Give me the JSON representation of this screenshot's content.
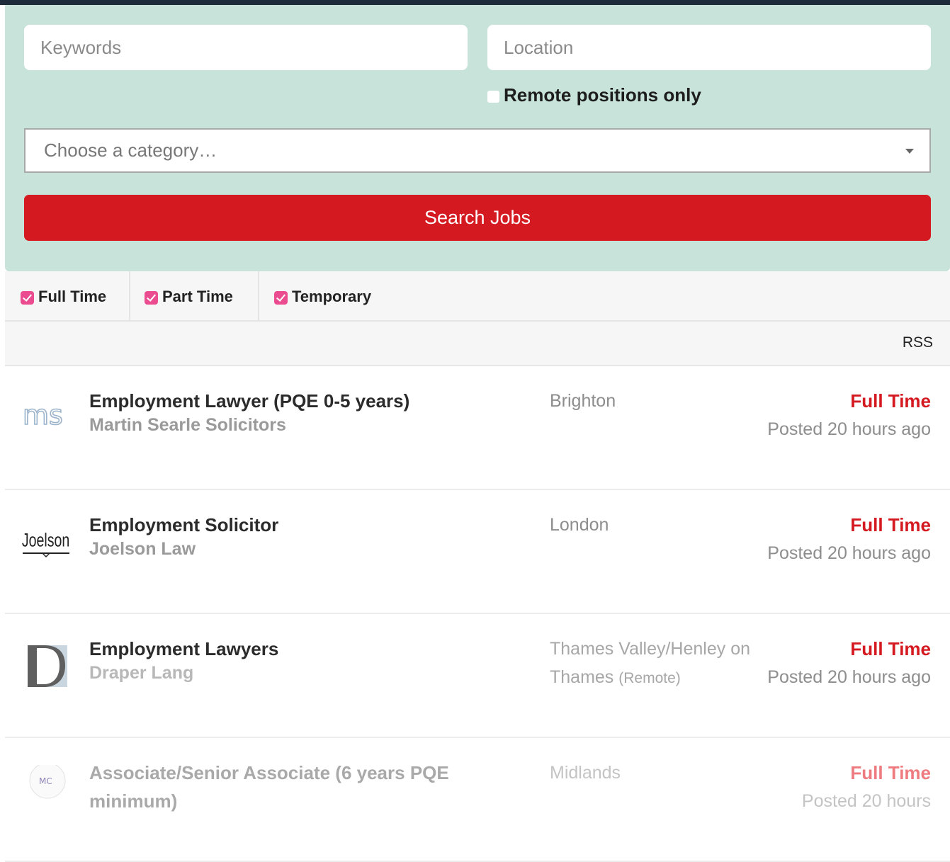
{
  "search": {
    "keywords_placeholder": "Keywords",
    "location_placeholder": "Location",
    "remote_label": "Remote positions only",
    "category_placeholder": "Choose a category…",
    "search_button": "Search Jobs"
  },
  "filters": [
    {
      "label": "Full Time",
      "checked": true
    },
    {
      "label": "Part Time",
      "checked": true
    },
    {
      "label": "Temporary",
      "checked": true
    }
  ],
  "rss_label": "RSS",
  "jobs": [
    {
      "title": "Employment Lawyer (PQE 0-5 years)",
      "company": "Martin Searle Solicitors",
      "location": "Brighton",
      "remote_tag": "",
      "type": "Full Time",
      "posted": "Posted 20 hours ago",
      "logo_text": "ms"
    },
    {
      "title": "Employment Solicitor",
      "company": "Joelson Law",
      "location": "London",
      "remote_tag": "",
      "type": "Full Time",
      "posted": "Posted 20 hours ago",
      "logo_text": "Joelson"
    },
    {
      "title": "Employment Lawyers",
      "company": "Draper Lang",
      "location": "Thames Valley/Henley on Thames",
      "remote_tag": "(Remote)",
      "type": "Full Time",
      "posted": "Posted 20 hours ago",
      "logo_text": ""
    },
    {
      "title": "Associate/Senior Associate (6 years PQE minimum)",
      "company": "",
      "location": "Midlands",
      "remote_tag": "",
      "type": "Full Time",
      "posted": "Posted 20 hours",
      "logo_text": "MC"
    }
  ],
  "colors": {
    "panel": "#c8e3da",
    "accent_red": "#d41a20",
    "checkbox_pink": "#ea4c8f"
  }
}
